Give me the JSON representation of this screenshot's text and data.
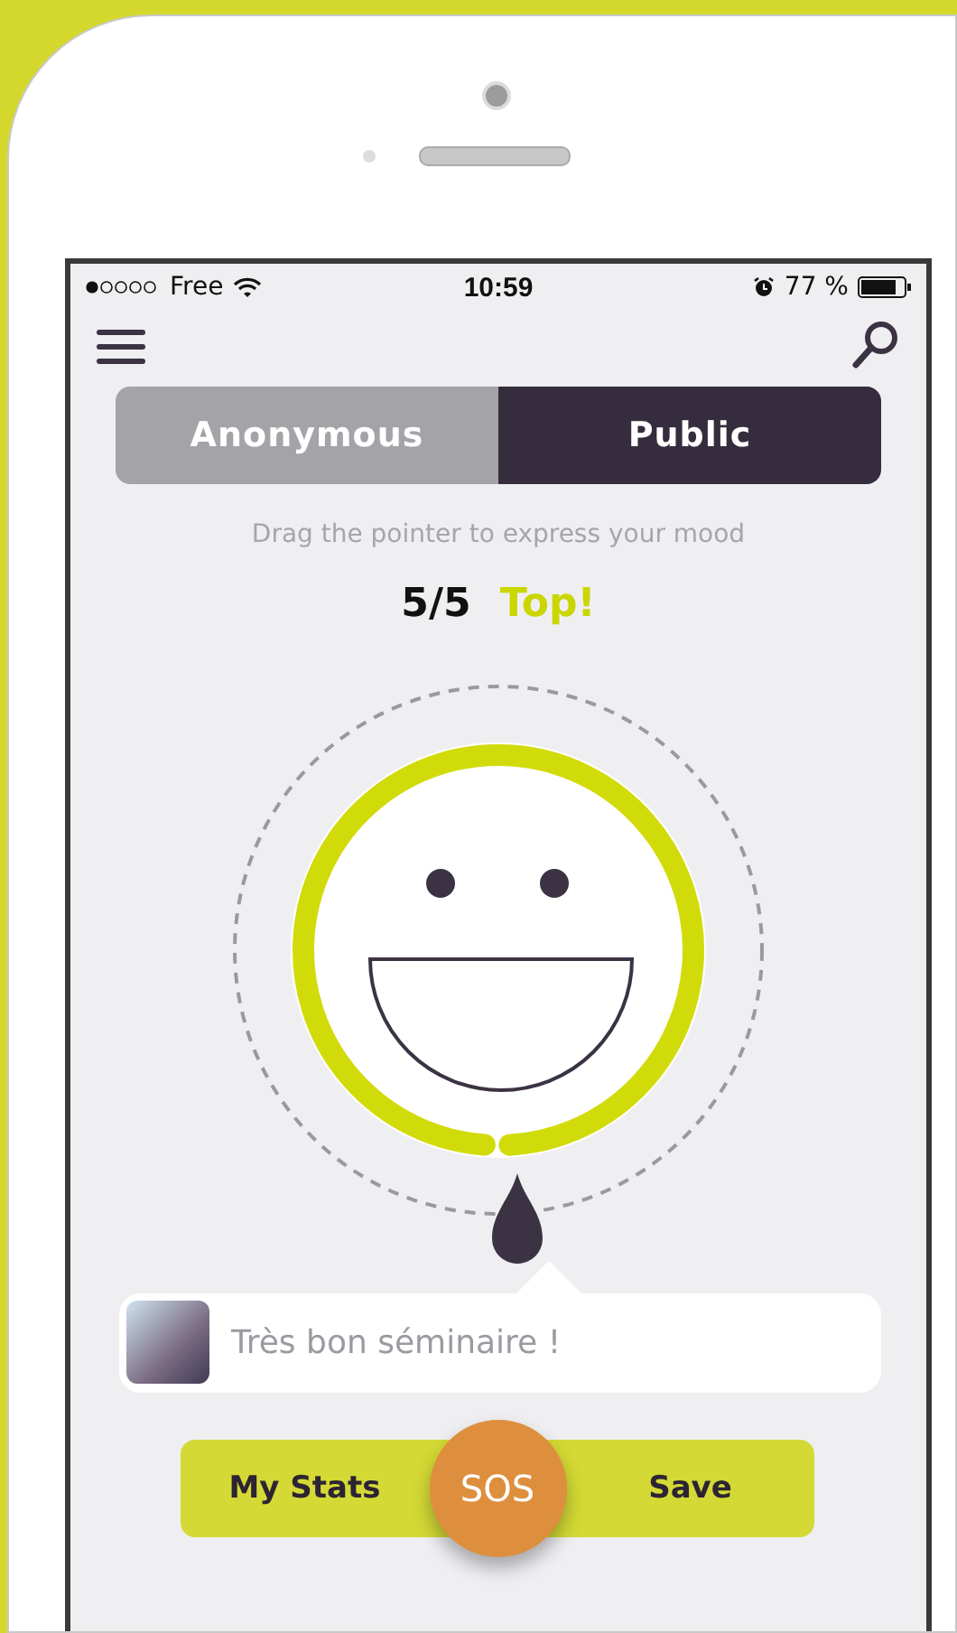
{
  "status_bar": {
    "carrier": "Free",
    "time": "10:59",
    "battery": "77 %"
  },
  "tabs": [
    {
      "label": "Anonymous",
      "selected": false
    },
    {
      "label": "Public",
      "selected": true
    }
  ],
  "hint": "Drag the pointer to express your mood",
  "mood": {
    "score": "5/5",
    "label": "Top!",
    "level": 1
  },
  "comment": {
    "value": "Très bon séminaire !"
  },
  "buttons": [
    {
      "label": "My Stats",
      "kind": "side"
    },
    {
      "label": "SOS",
      "kind": "round"
    },
    {
      "label": "Save",
      "kind": "side"
    }
  ]
}
